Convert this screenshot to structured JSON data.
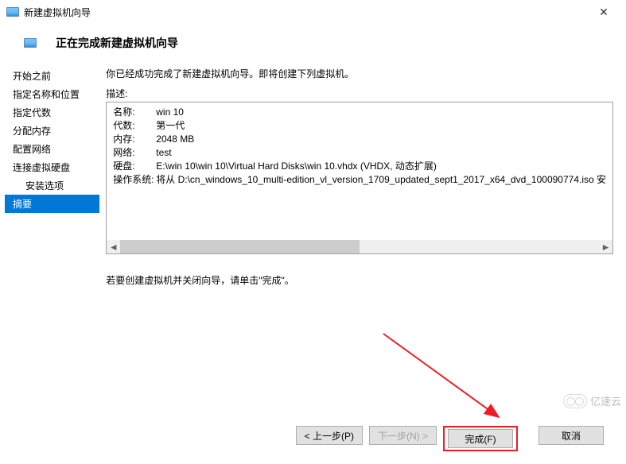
{
  "titlebar": {
    "title": "新建虚拟机向导"
  },
  "header": {
    "title": "正在完成新建虚拟机向导"
  },
  "sidebar": {
    "items": [
      {
        "label": "开始之前",
        "indent": false
      },
      {
        "label": "指定名称和位置",
        "indent": false
      },
      {
        "label": "指定代数",
        "indent": false
      },
      {
        "label": "分配内存",
        "indent": false
      },
      {
        "label": "配置网络",
        "indent": false
      },
      {
        "label": "连接虚拟硬盘",
        "indent": false
      },
      {
        "label": "安装选项",
        "indent": true
      },
      {
        "label": "摘要",
        "indent": false,
        "selected": true
      }
    ]
  },
  "content": {
    "intro": "你已经成功完成了新建虚拟机向导。即将创建下列虚拟机。",
    "desc_label": "描述:",
    "details": [
      {
        "label": "名称:",
        "value": "win  10"
      },
      {
        "label": "代数:",
        "value": "第一代"
      },
      {
        "label": "内存:",
        "value": "2048 MB"
      },
      {
        "label": "网络:",
        "value": "test"
      },
      {
        "label": "硬盘:",
        "value": "E:\\win 10\\win  10\\Virtual Hard Disks\\win  10.vhdx (VHDX, 动态扩展)"
      },
      {
        "label": "操作系统:",
        "value": "将从 D:\\cn_windows_10_multi-edition_vl_version_1709_updated_sept1_2017_x64_dvd_100090774.iso 安"
      }
    ],
    "close_hint": "若要创建虚拟机并关闭向导，请单击\"完成\"。"
  },
  "footer": {
    "prev": "< 上一步(P)",
    "next": "下一步(N) >",
    "finish": "完成(F)",
    "cancel": "取消"
  },
  "watermark": {
    "text": "亿速云"
  }
}
